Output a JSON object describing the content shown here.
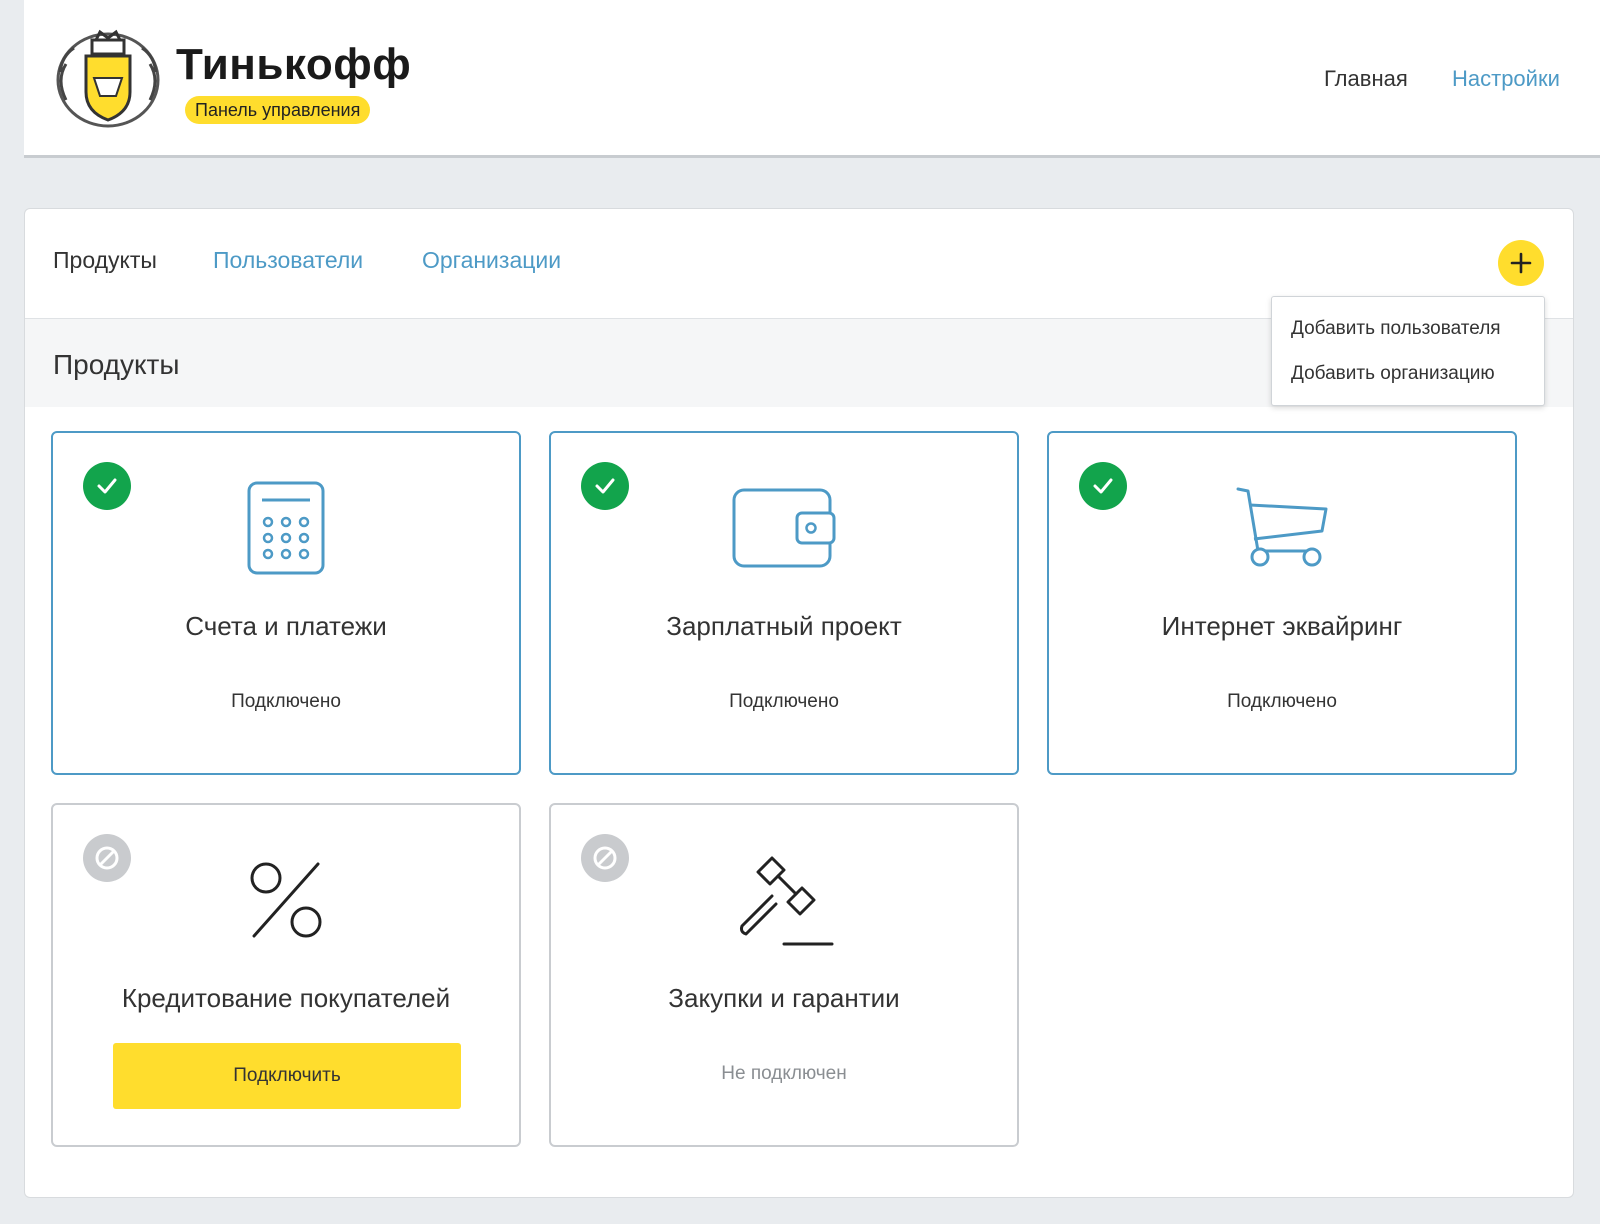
{
  "header": {
    "brand_name": "Тинькофф",
    "brand_badge": "Панель управления",
    "nav": {
      "home": "Главная",
      "settings": "Настройки"
    }
  },
  "tabs": {
    "products": "Продукты",
    "users": "Пользователи",
    "organizations": "Организации"
  },
  "section_title": "Продукты",
  "add_menu": {
    "icon": "plus-icon",
    "items": [
      "Добавить пользователя",
      "Добавить организацию"
    ]
  },
  "products": [
    {
      "title": "Счета и платежи",
      "status": "Подключено",
      "connected": true,
      "icon": "calculator-icon"
    },
    {
      "title": "Зарплатный проект",
      "status": "Подключено",
      "connected": true,
      "icon": "wallet-icon"
    },
    {
      "title": "Интернет эквайринг",
      "status": "Подключено",
      "connected": true,
      "icon": "cart-icon"
    },
    {
      "title": "Кредитование покупателей",
      "action": "Подключить",
      "connected": false,
      "icon": "percent-icon"
    },
    {
      "title": "Закупки и гарантии",
      "status": "Не подключен",
      "connected": false,
      "icon": "gavel-icon"
    }
  ],
  "colors": {
    "accent": "#ffdd2d",
    "link": "#4d9ac6",
    "success": "#12a44c",
    "disabled": "#c9cbce"
  }
}
